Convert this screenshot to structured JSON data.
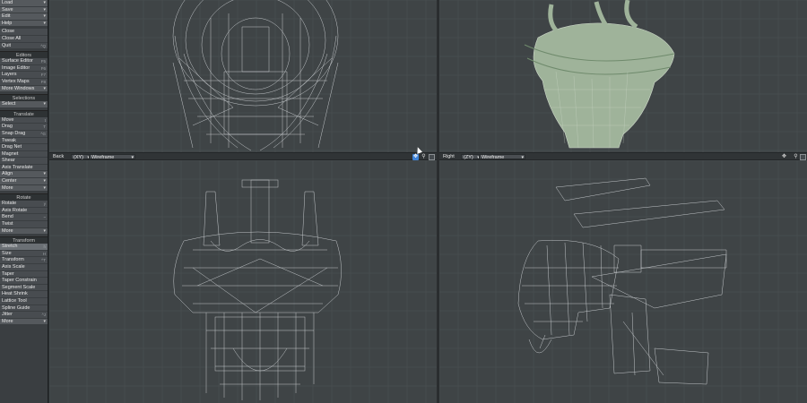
{
  "toolbar": {
    "file_items": [
      {
        "label": "Load",
        "key": ""
      },
      {
        "label": "Save",
        "key": ""
      },
      {
        "label": "Edit",
        "key": ""
      },
      {
        "label": "Help",
        "key": ""
      },
      {
        "label": "Close",
        "key": ""
      },
      {
        "label": "Close All",
        "key": ""
      },
      {
        "label": "Quit",
        "key": "^Q"
      }
    ],
    "editors_header": "Editors",
    "editors_items": [
      {
        "label": "Surface Editor",
        "key": "F5"
      },
      {
        "label": "Image Editor",
        "key": "F6"
      },
      {
        "label": "Layers",
        "key": "F7"
      },
      {
        "label": "Vertex Maps",
        "key": "F8"
      },
      {
        "label": "More Windows",
        "key": ""
      }
    ],
    "selections_header": "Selections",
    "selections_items": [
      {
        "label": "Select",
        "key": ""
      }
    ],
    "translate_header": "Translate",
    "translate_items": [
      {
        "label": "Move",
        "key": "t"
      },
      {
        "label": "Drag",
        "key": "T"
      },
      {
        "label": "Snap Drag",
        "key": "^G"
      },
      {
        "label": "Tweak",
        "key": ""
      },
      {
        "label": "Drag Net",
        "key": ""
      },
      {
        "label": "Magnet",
        "key": ""
      },
      {
        "label": "Shear",
        "key": ""
      },
      {
        "label": "Axis Translate",
        "key": ""
      },
      {
        "label": "Align",
        "key": ""
      },
      {
        "label": "Center",
        "key": ""
      },
      {
        "label": "More",
        "key": ""
      }
    ],
    "rotate_header": "Rotate",
    "rotate_items": [
      {
        "label": "Rotate",
        "key": "y"
      },
      {
        "label": "Axis Rotate",
        "key": ""
      },
      {
        "label": "Bend",
        "key": "~"
      },
      {
        "label": "Twist",
        "key": ""
      },
      {
        "label": "More",
        "key": ""
      }
    ],
    "transform_header": "Transform",
    "transform_items": [
      {
        "label": "Stretch",
        "key": "h"
      },
      {
        "label": "Size",
        "key": "H"
      },
      {
        "label": "Transform",
        "key": "^T"
      },
      {
        "label": "Axis Scale",
        "key": ""
      },
      {
        "label": "Taper",
        "key": ""
      },
      {
        "label": "Taper Constrain",
        "key": ""
      },
      {
        "label": "Segment Scale",
        "key": ""
      },
      {
        "label": "Heat Shrink",
        "key": ""
      },
      {
        "label": "Lattice Tool",
        "key": ""
      },
      {
        "label": "Spline Guide",
        "key": ""
      },
      {
        "label": "Jitter",
        "key": "^J"
      },
      {
        "label": "More",
        "key": ""
      }
    ]
  },
  "viewport_left_header": {
    "view": "Back",
    "axis": "(XY)",
    "mode": "Wireframe"
  },
  "viewport_right_header": {
    "view": "Right",
    "axis": "(ZY)",
    "mode": "Wireframe"
  },
  "colors": {
    "grid_bg": "#3f4446",
    "grid_line": "#4c5254",
    "wire": "#d9dde0",
    "shaded": "#9fb39a"
  }
}
